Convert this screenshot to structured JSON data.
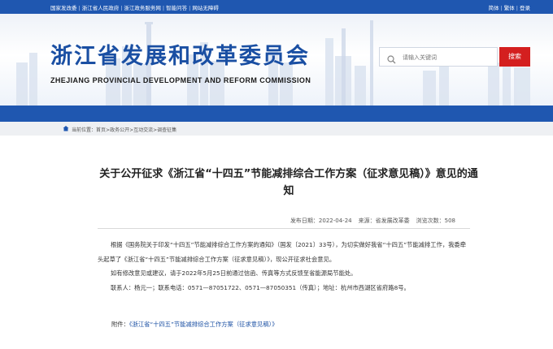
{
  "topbar": {
    "links": [
      "国家发改委",
      "浙江省人民政府",
      "浙江政务服务网",
      "智能问答",
      "网站无障碍"
    ],
    "lang_simplified": "简体",
    "lang_traditional": "繁体",
    "login": "登录"
  },
  "header": {
    "site_name_cn": "浙江省发展和改革委员会",
    "site_name_en": "ZHEJIANG PROVINCIAL DEVELOPMENT AND REFORM COMMISSION",
    "search_placeholder": "请输入关键词",
    "search_button": "搜索"
  },
  "breadcrumb": {
    "label": "当前位置：",
    "items": [
      "首页",
      "政务公开",
      "互动交流",
      "调查征集"
    ],
    "separator": ">"
  },
  "article": {
    "title": "关于公开征求《浙江省“十四五”节能减排综合工作方案（征求意见稿）》意见的通知",
    "publish_date": "发布日期：2022-04-24",
    "source": "来源：省发展改革委",
    "views": "浏览次数：508",
    "paragraph_1": "根据《国务院关于印发“十四五”节能减排综合工作方案的通知》（国发〔2021〕33号），为切实做好我省“十四五”节能减排工作，我委牵头起草了《浙江省“十四五”节能减排综合工作方案（征求意见稿）》，现公开征求社会意见。",
    "paragraph_2": "如有修改意见或建议，请于2022年5月25日前通过信函、传真等方式反馈至省能源局节能处。",
    "paragraph_3": "联系人：杨元一；联系电话：0571—87051722、0571—87050351（传真）；地址：杭州市西湖区省府路8号。",
    "attachment_label": "附件：",
    "attachment_link": "《浙江省“十四五”节能减排综合工作方案（征求意见稿）》"
  },
  "colors": {
    "brand_blue": "#1f57b0",
    "search_red": "#d41f1f",
    "link_blue": "#1a4fa3"
  }
}
